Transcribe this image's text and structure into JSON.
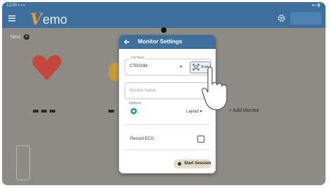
{
  "status_bar": {
    "left": "12:00 ▪ ▪ ▪",
    "right": "◂ ▪ ▮"
  },
  "app_bar": {
    "logo_v": "V",
    "logo_rest": "emo",
    "action_button": "",
    "menu_icon": "menu-icon",
    "settings_icon": "gear-icon"
  },
  "page": {
    "tab_label": "New",
    "tab_close": "×",
    "add_monitor": "+ Add Monitor"
  },
  "dialog": {
    "title": "Monitor Settings",
    "back_icon": "arrow-left-icon",
    "device_field": {
      "label": "Lot Num",
      "value": "CTR0198",
      "scan_label": "Scan"
    },
    "name_field": {
      "placeholder": "Monitor Name"
    },
    "options": {
      "label": "Options",
      "layout_value": "Layout"
    },
    "record": {
      "label": "Record ECG",
      "checked": false
    },
    "start_button": "Start Session"
  },
  "colors": {
    "app_bar": "#3f6f9c",
    "backdrop": "#8e8b86",
    "logo_accent": "#f09a2a",
    "heart": "#c4473c"
  }
}
